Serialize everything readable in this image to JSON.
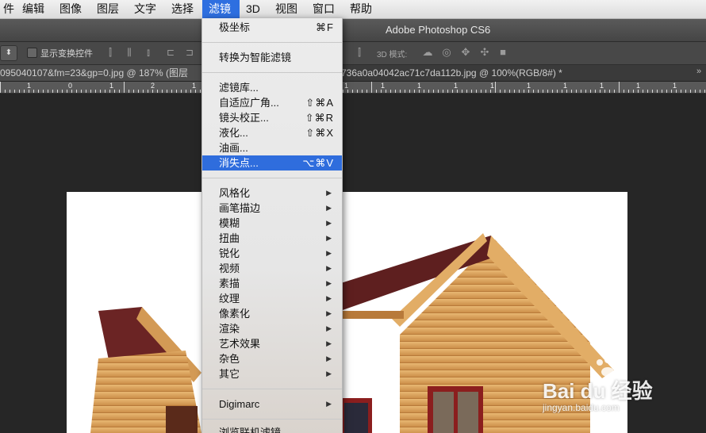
{
  "menubar": {
    "items": [
      {
        "label": "件"
      },
      {
        "label": "编辑"
      },
      {
        "label": "图像"
      },
      {
        "label": "图层"
      },
      {
        "label": "文字"
      },
      {
        "label": "选择"
      },
      {
        "label": "滤镜",
        "active": true
      },
      {
        "label": "3D"
      },
      {
        "label": "视图"
      },
      {
        "label": "窗口"
      },
      {
        "label": "帮助"
      }
    ]
  },
  "window": {
    "title": "Adobe Photoshop CS6"
  },
  "options_bar": {
    "checkbox_label": "显示变换控件",
    "mode_label": "3D 模式:"
  },
  "tabs": {
    "first": "095040107&fm=23&gp=0.jpg @ 187% (图层",
    "second": "736a0a04042ac71c7da112b.jpg @ 100%(RGB/8#) *"
  },
  "ruler": {
    "labels": [
      "1",
      "0",
      "1",
      "2",
      "1",
      "1",
      "1",
      "1",
      "1",
      "1",
      "1",
      "1",
      "1",
      "1",
      "1"
    ]
  },
  "filter_menu": {
    "items": [
      {
        "label": "极坐标",
        "shortcut": "⌘F"
      },
      {
        "label": "转换为智能滤镜",
        "shortcut": ""
      },
      {
        "label": "滤镜库...",
        "shortcut": ""
      },
      {
        "label": "自适应广角...",
        "shortcut": "⇧⌘A"
      },
      {
        "label": "镜头校正...",
        "shortcut": "⇧⌘R"
      },
      {
        "label": "液化...",
        "shortcut": "⇧⌘X"
      },
      {
        "label": "油画...",
        "shortcut": ""
      },
      {
        "label": "消失点...",
        "shortcut": "⌥⌘V",
        "highlighted": true
      },
      {
        "label": "风格化"
      },
      {
        "label": "画笔描边"
      },
      {
        "label": "模糊"
      },
      {
        "label": "扭曲"
      },
      {
        "label": "锐化"
      },
      {
        "label": "视频"
      },
      {
        "label": "素描"
      },
      {
        "label": "纹理"
      },
      {
        "label": "像素化"
      },
      {
        "label": "渲染"
      },
      {
        "label": "艺术效果"
      },
      {
        "label": "杂色"
      },
      {
        "label": "其它"
      },
      {
        "label": "Digimarc"
      },
      {
        "label": "浏览联机滤镜..."
      }
    ]
  },
  "watermark": {
    "brand": "Bai du 经验",
    "url": "jingyan.baidu.com"
  },
  "colors": {
    "highlight": "#2f6ddd",
    "roof": "#6b2424",
    "wood": "#d9a25a"
  }
}
